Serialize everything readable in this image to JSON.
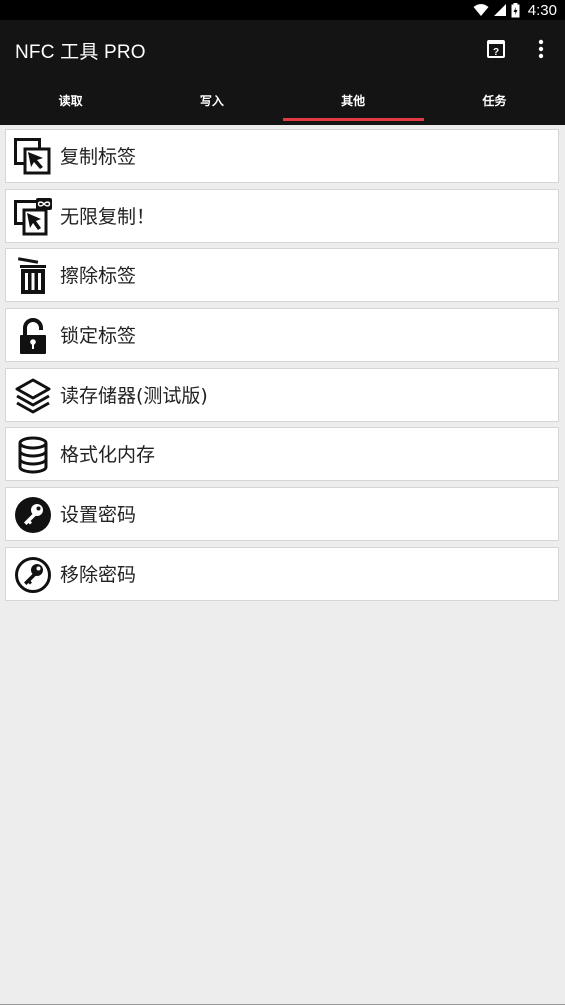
{
  "status_bar": {
    "time": "4:30"
  },
  "app_bar": {
    "title": "NFC 工具 PRO"
  },
  "tabs": [
    {
      "label": "读取",
      "active": false
    },
    {
      "label": "写入",
      "active": false
    },
    {
      "label": "其他",
      "active": true
    },
    {
      "label": "任务",
      "active": false
    }
  ],
  "menu_items": [
    {
      "label": "复制标签",
      "icon": "copy-tag-icon"
    },
    {
      "label": "无限复制！",
      "icon": "infinite-copy-icon"
    },
    {
      "label": "擦除标签",
      "icon": "trash-icon"
    },
    {
      "label": "锁定标签",
      "icon": "lock-icon"
    },
    {
      "label": "读存储器(测试版)",
      "icon": "layers-icon"
    },
    {
      "label": "格式化内存",
      "icon": "database-icon"
    },
    {
      "label": "设置密码",
      "icon": "key-filled-icon"
    },
    {
      "label": "移除密码",
      "icon": "key-outline-icon"
    }
  ],
  "colors": {
    "accent": "#e23a45",
    "toolbar": "#141414",
    "background": "#ededed"
  }
}
